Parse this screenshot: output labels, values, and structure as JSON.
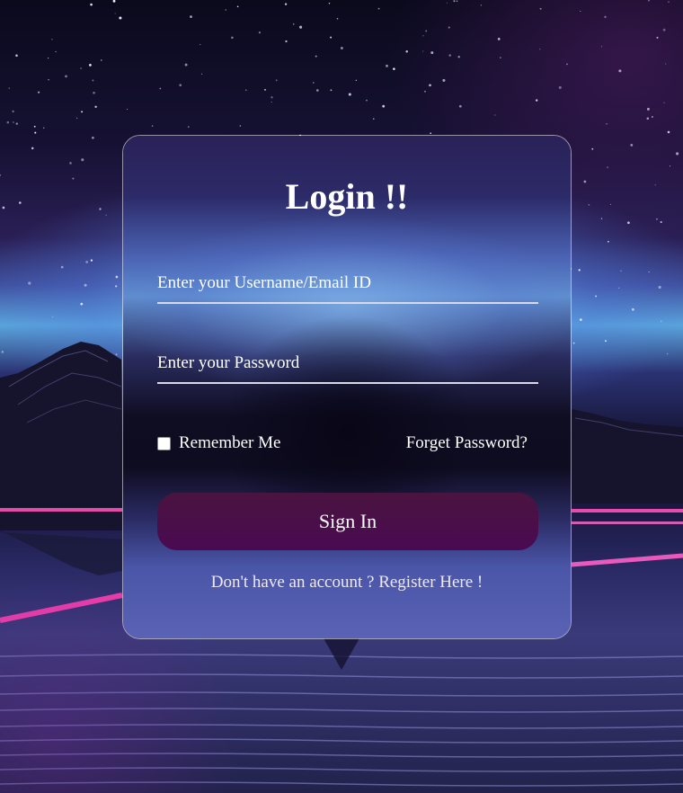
{
  "login": {
    "title": "Login !!",
    "username_placeholder": "Enter your Username/Email ID",
    "username_value": "",
    "password_placeholder": "Enter your Password",
    "password_value": "",
    "remember_label": "Remember Me",
    "remember_checked": false,
    "forget_label": "Forget Password?",
    "signin_label": "Sign In",
    "register_prompt": "Don't have an account ? ",
    "register_link": "Register Here !"
  },
  "colors": {
    "signin_button": "#4a0a52",
    "text": "#ffffff",
    "field_underline": "#d8d8e6",
    "card_border": "#ffffff"
  }
}
